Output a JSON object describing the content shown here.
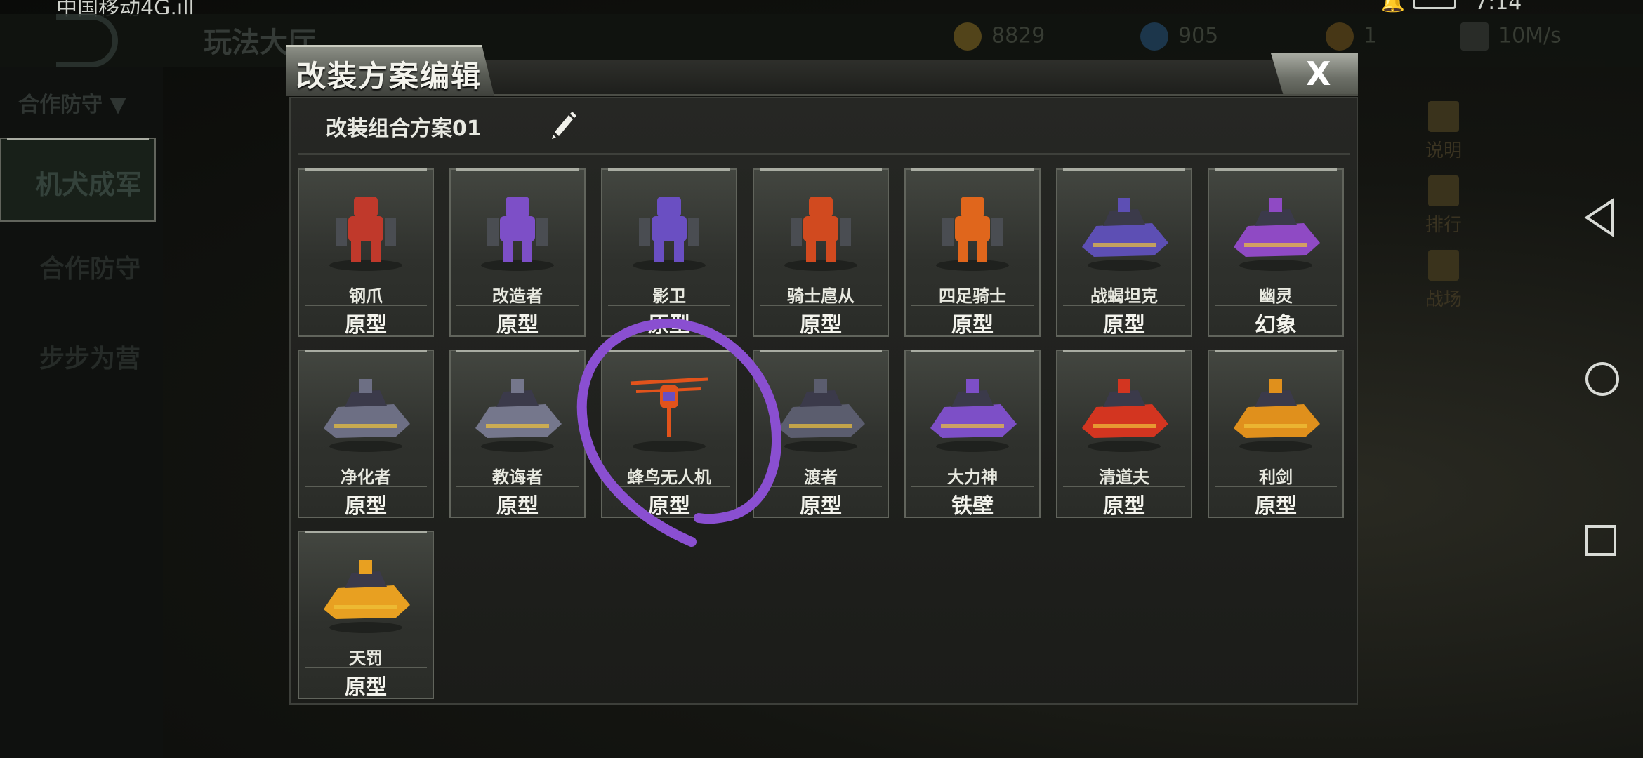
{
  "status": {
    "carrier": "中国移动4G.ıll",
    "time": "7:14"
  },
  "top": {
    "title": "玩法大厅",
    "gold": "8829",
    "diamond": "905",
    "tickets": "1",
    "speed": "10M/s"
  },
  "sidebar": {
    "mode": "合作防守 ▼",
    "card": "机犬成军",
    "items": [
      "合作防守",
      "步步为营"
    ]
  },
  "rightcol": [
    "说明",
    "排行",
    "战场"
  ],
  "modal": {
    "title": "改装方案编辑",
    "close": "X",
    "scheme": "改装组合方案01",
    "units": [
      {
        "name": "钢爪",
        "form": "原型",
        "icon": "red-mech-dog",
        "color": "#c0392b"
      },
      {
        "name": "改造者",
        "form": "原型",
        "icon": "purple-mech",
        "color": "#7d4fc7"
      },
      {
        "name": "影卫",
        "form": "原型",
        "icon": "dark-mech",
        "color": "#6a4fc2"
      },
      {
        "name": "骑士扈从",
        "form": "原型",
        "icon": "red-knight-mech",
        "color": "#d14a1f"
      },
      {
        "name": "四足骑士",
        "form": "原型",
        "icon": "orange-quad-mech",
        "color": "#e0661c"
      },
      {
        "name": "战蝎坦克",
        "form": "原型",
        "icon": "purple-tank",
        "color": "#5d4fb4"
      },
      {
        "name": "幽灵",
        "form": "幻象",
        "icon": "ghost-tank",
        "color": "#8f4ac4"
      },
      {
        "name": "净化者",
        "form": "原型",
        "icon": "gray-apc",
        "color": "#6d6f84"
      },
      {
        "name": "教诲者",
        "form": "原型",
        "icon": "gray-tank",
        "color": "#75778c"
      },
      {
        "name": "蜂鸟无人机",
        "form": "原型",
        "icon": "drone-icon",
        "color": "#e2531b"
      },
      {
        "name": "渡者",
        "form": "原型",
        "icon": "gray-quadcopter",
        "color": "#5b5d6e"
      },
      {
        "name": "大力神",
        "form": "铁壁",
        "icon": "purple-hover",
        "color": "#7d4fc7"
      },
      {
        "name": "清道夫",
        "form": "原型",
        "icon": "red-hovercraft",
        "color": "#d33520"
      },
      {
        "name": "利剑",
        "form": "原型",
        "icon": "yellow-hover",
        "color": "#e0901c"
      },
      {
        "name": "天罚",
        "form": "原型",
        "icon": "yellow-hovercraft",
        "color": "#e8a021"
      }
    ]
  },
  "annotation": {
    "color": "#8a4fd1"
  }
}
